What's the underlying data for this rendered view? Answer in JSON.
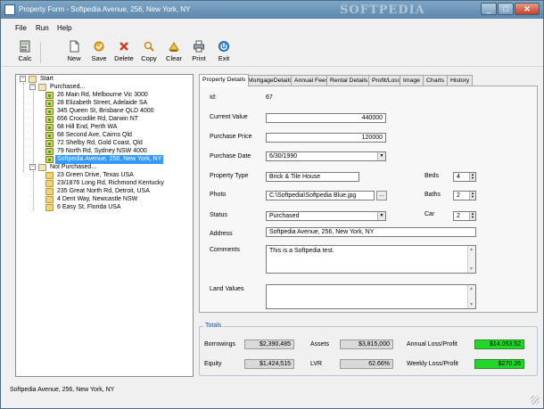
{
  "window": {
    "title": "Property Form - Softpedia Avenue, 256, New York, NY",
    "watermark": "SOFTPEDIA"
  },
  "menu": [
    "File",
    "Run",
    "Help"
  ],
  "toolbar": {
    "calc": "Calc",
    "new": "New",
    "save": "Save",
    "delete": "Delete",
    "copy": "Copy",
    "clear": "Clear",
    "print": "Print",
    "exit": "Exit"
  },
  "tree": {
    "root": "Start",
    "purchased": {
      "label": "Purchased...",
      "items": [
        "26 Main Rd, Melbourne Vic 3000",
        "28 Elizabeth Street, Adelaide SA",
        "345 Queen St, Brisbane QLD 4000",
        "656 Crocodile Rd, Darwin NT",
        "68 Hill End, Perth WA",
        "68 Second Ave, Cairns Qld",
        "72 Shelby Rd, Gold Coast, Qld",
        "79 North Rd, Sydney NSW 4000",
        "Softpedia Avenue, 256, New York, NY"
      ]
    },
    "not_purchased": {
      "label": "Not Purchased...",
      "items": [
        "23 Green Drive, Texas USA",
        "23/1876 Long Rd, Richmond Kentucky",
        "235 Great North Rd, Detroit, USA",
        "4 Dent Way, Newcastle NSW",
        "6 Easy St, Florida USA"
      ]
    }
  },
  "tabs": [
    "Property Details",
    "MortgageDetails",
    "Annual Fees",
    "Rental Details",
    "Profit/Loss",
    "Image",
    "Charts",
    "History"
  ],
  "form": {
    "id_label": "Id:",
    "id_value": "67",
    "current_value_label": "Current Value",
    "current_value": "440000",
    "purchase_price_label": "Purchase Price",
    "purchase_price": "120000",
    "purchase_date_label": "Purchase Date",
    "purchase_date": "6/30/1990",
    "property_type_label": "Property Type",
    "property_type": "Brick & Tile House",
    "beds_label": "Beds",
    "beds": "4",
    "photo_label": "Photo",
    "photo": "C:\\Softpedia\\Softpedia Blue.jpg",
    "browse": "...",
    "baths_label": "Baths",
    "baths": "2",
    "status_label": "Status",
    "status": "Purchased",
    "car_label": "Car",
    "car": "2",
    "address_label": "Address",
    "address": "Softpedia Avenue, 256, New York, NY",
    "comments_label": "Comments",
    "comments": "This is a Softpedia test.",
    "land_values_label": "Land Values",
    "land_values": ""
  },
  "totals": {
    "title": "Totals",
    "borrowings_label": "Borrowings",
    "borrowings": "$2,390,485",
    "assets_label": "Assets",
    "assets": "$3,815,000",
    "annual_label": "Annual Loss/Profit",
    "annual": "$14,053.52",
    "equity_label": "Equity",
    "equity": "$1,424,515",
    "lvr_label": "LVR",
    "lvr": "62.66%",
    "weekly_label": "Weekly Loss/Profit",
    "weekly": "$270.26"
  },
  "status_bar": "Softpedia Avenue, 256, New York, NY",
  "colors": {
    "selection": "#3399ff",
    "profit_green": "#22d62a",
    "totals_title": "#1c4b9a"
  }
}
